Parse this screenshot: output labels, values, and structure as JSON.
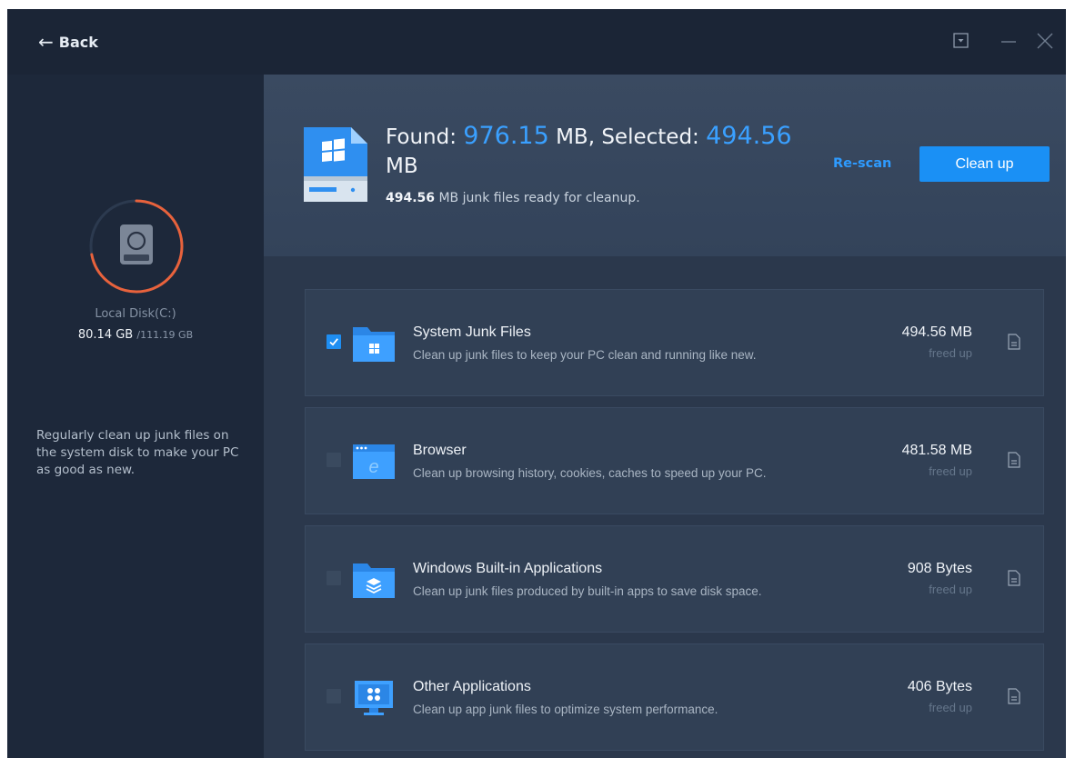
{
  "titlebar": {
    "back_label": "Back",
    "icons": [
      "back-arrow-icon",
      "dropdown-menu-icon",
      "minimize-icon",
      "close-icon"
    ]
  },
  "sidebar": {
    "disk_name": "Local Disk(C:)",
    "disk_used": "80.14 GB",
    "disk_total": "/111.19 GB",
    "disk_used_fraction": 0.72,
    "tip": "Regularly clean up junk files on the system disk to make your PC as good as new."
  },
  "summary": {
    "found_label": "Found: ",
    "found_value": "976.15",
    "found_unit": " MB, Selected: ",
    "selected_value": "494.56",
    "selected_unit": " MB",
    "ready_value": "494.56",
    "ready_text": " MB junk files ready for cleanup.",
    "rescan_label": "Re-scan",
    "cleanup_label": "Clean up"
  },
  "categories": [
    {
      "title": "System Junk Files",
      "description": "Clean up junk files to keep your PC clean and running like new.",
      "size": "494.56 MB",
      "freed_label": "freed up",
      "checked": true,
      "icon": "windows-folder-icon"
    },
    {
      "title": "Browser",
      "description": "Clean up browsing history, cookies, caches to speed up your PC.",
      "size": "481.58 MB",
      "freed_label": "freed up",
      "checked": false,
      "icon": "browser-window-icon"
    },
    {
      "title": "Windows Built-in Applications",
      "description": "Clean up junk files produced by built-in apps to save disk space.",
      "size": "908 Bytes",
      "freed_label": "freed up",
      "checked": false,
      "icon": "apps-folder-icon"
    },
    {
      "title": "Other Applications",
      "description": "Clean up app junk files to optimize system performance.",
      "size": "406 Bytes",
      "freed_label": "freed up",
      "checked": false,
      "icon": "monitor-apps-icon"
    }
  ],
  "colors": {
    "accent": "#1a90f5",
    "highlight_number": "#3aa0ff",
    "disk_ring": "#e8623c",
    "background": "#233044"
  }
}
